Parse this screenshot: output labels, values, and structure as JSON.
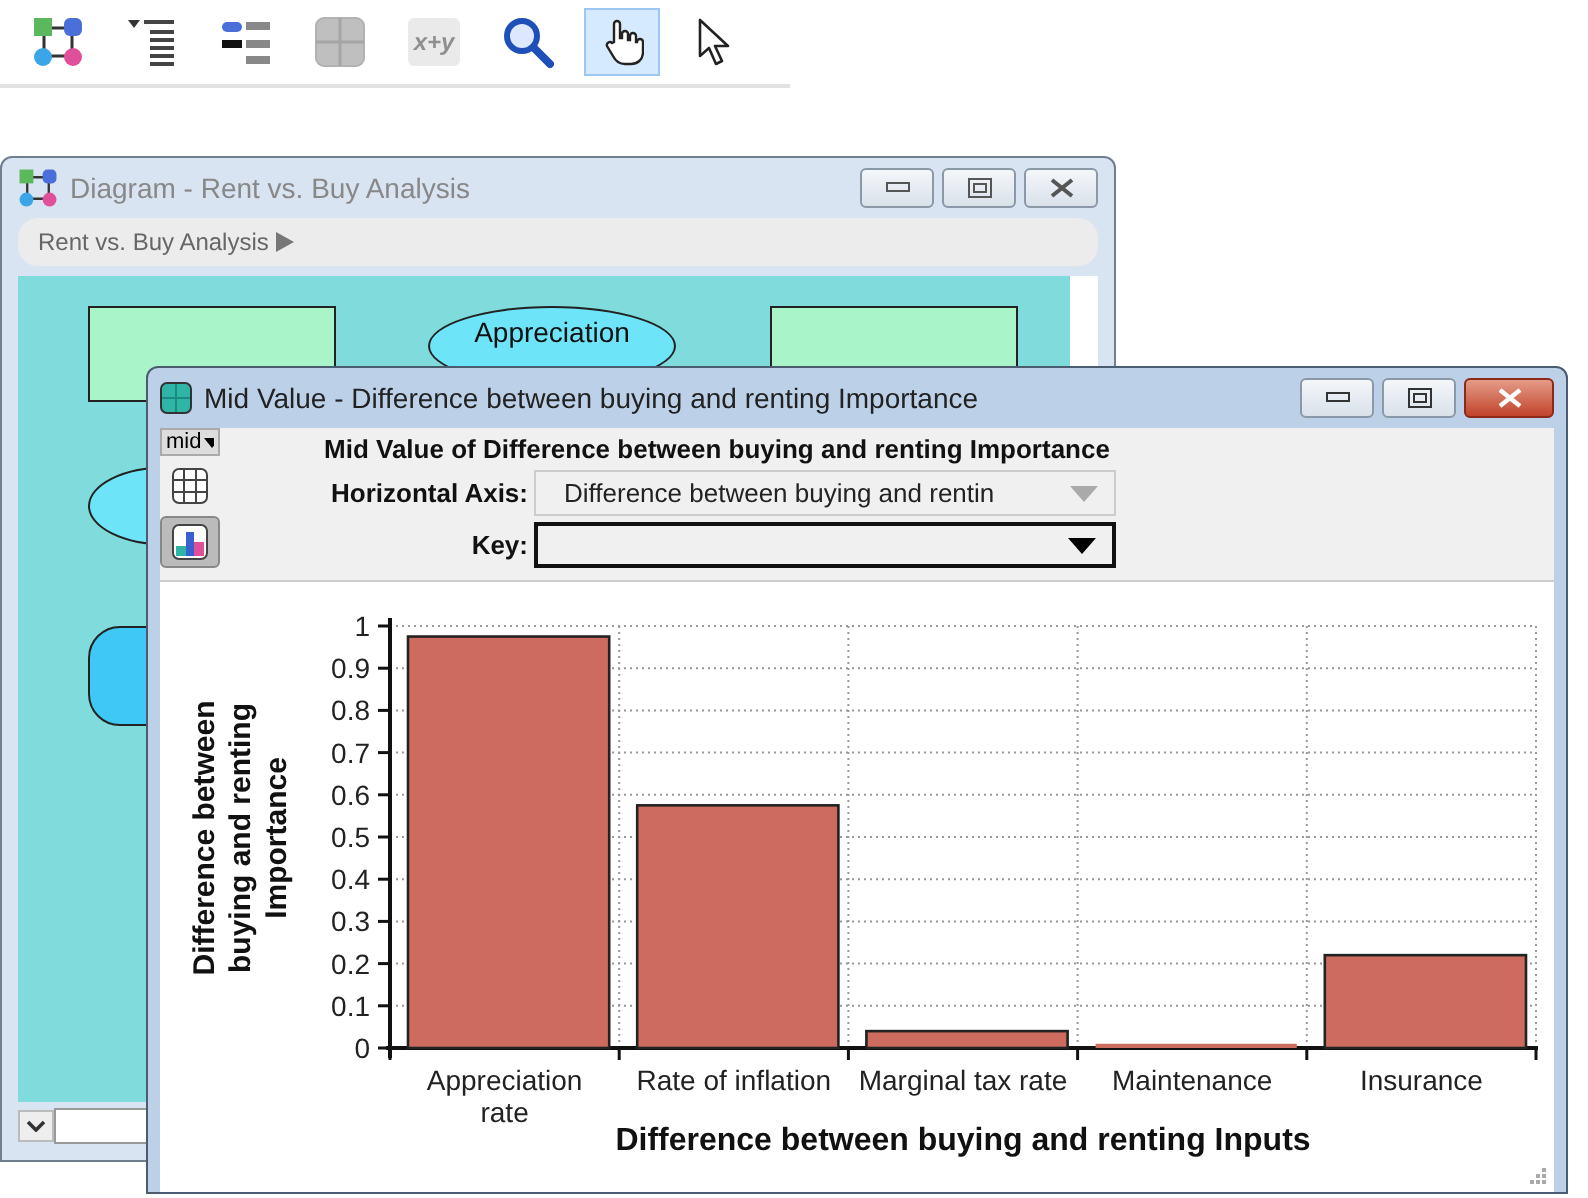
{
  "toolbar": [
    {
      "kind": "diagram",
      "selected": false,
      "disabled": false
    },
    {
      "kind": "outline",
      "selected": false,
      "disabled": false
    },
    {
      "kind": "attributes",
      "selected": false,
      "disabled": false
    },
    {
      "kind": "table",
      "selected": false,
      "disabled": true
    },
    {
      "kind": "expression",
      "label": "x+y",
      "selected": false,
      "disabled": true
    },
    {
      "kind": "search",
      "selected": false,
      "disabled": false
    },
    {
      "kind": "hand",
      "selected": true,
      "disabled": false
    },
    {
      "kind": "pointer",
      "selected": false,
      "disabled": false
    }
  ],
  "diagram_window": {
    "title": "Diagram - Rent vs. Buy Analysis",
    "breadcrumb": "Rent vs. Buy Analysis",
    "nodes": [
      {
        "kind": "decision"
      },
      {
        "kind": "chance",
        "label": "Appreciation"
      },
      {
        "kind": "decision"
      },
      {
        "kind": "chance"
      },
      {
        "kind": "objective"
      }
    ]
  },
  "result_window": {
    "title": "Mid Value - Difference between buying and renting Importance",
    "view_selector": "mid",
    "views": [
      {
        "kind": "table",
        "selected": false
      },
      {
        "kind": "graph",
        "selected": true
      }
    ],
    "heading": "Mid Value of Difference between buying and renting Importance",
    "horizontal_axis": {
      "label": "Horizontal Axis:",
      "value": "Difference between buying and rentin",
      "disabled": true
    },
    "key": {
      "label": "Key:",
      "disabled": false
    },
    "chart_data": {
      "type": "bar",
      "xlabel": "Difference between buying and renting Inputs",
      "ylabel": "Difference between buying and renting Importance",
      "categories": [
        "Appreciation rate",
        "Rate of inflation",
        "Marginal tax rate",
        "Maintenance",
        "Insurance"
      ],
      "grid": true,
      "series": [
        {
          "color": "#cd6b5e",
          "values": [
            0.975,
            0.575,
            0.04,
            0.01,
            0.22
          ]
        }
      ],
      "ylim": [
        0,
        1
      ],
      "yticks": [
        0,
        0.1,
        0.2,
        0.3,
        0.4,
        0.5,
        0.6,
        0.7,
        0.8,
        0.9,
        1
      ]
    }
  }
}
